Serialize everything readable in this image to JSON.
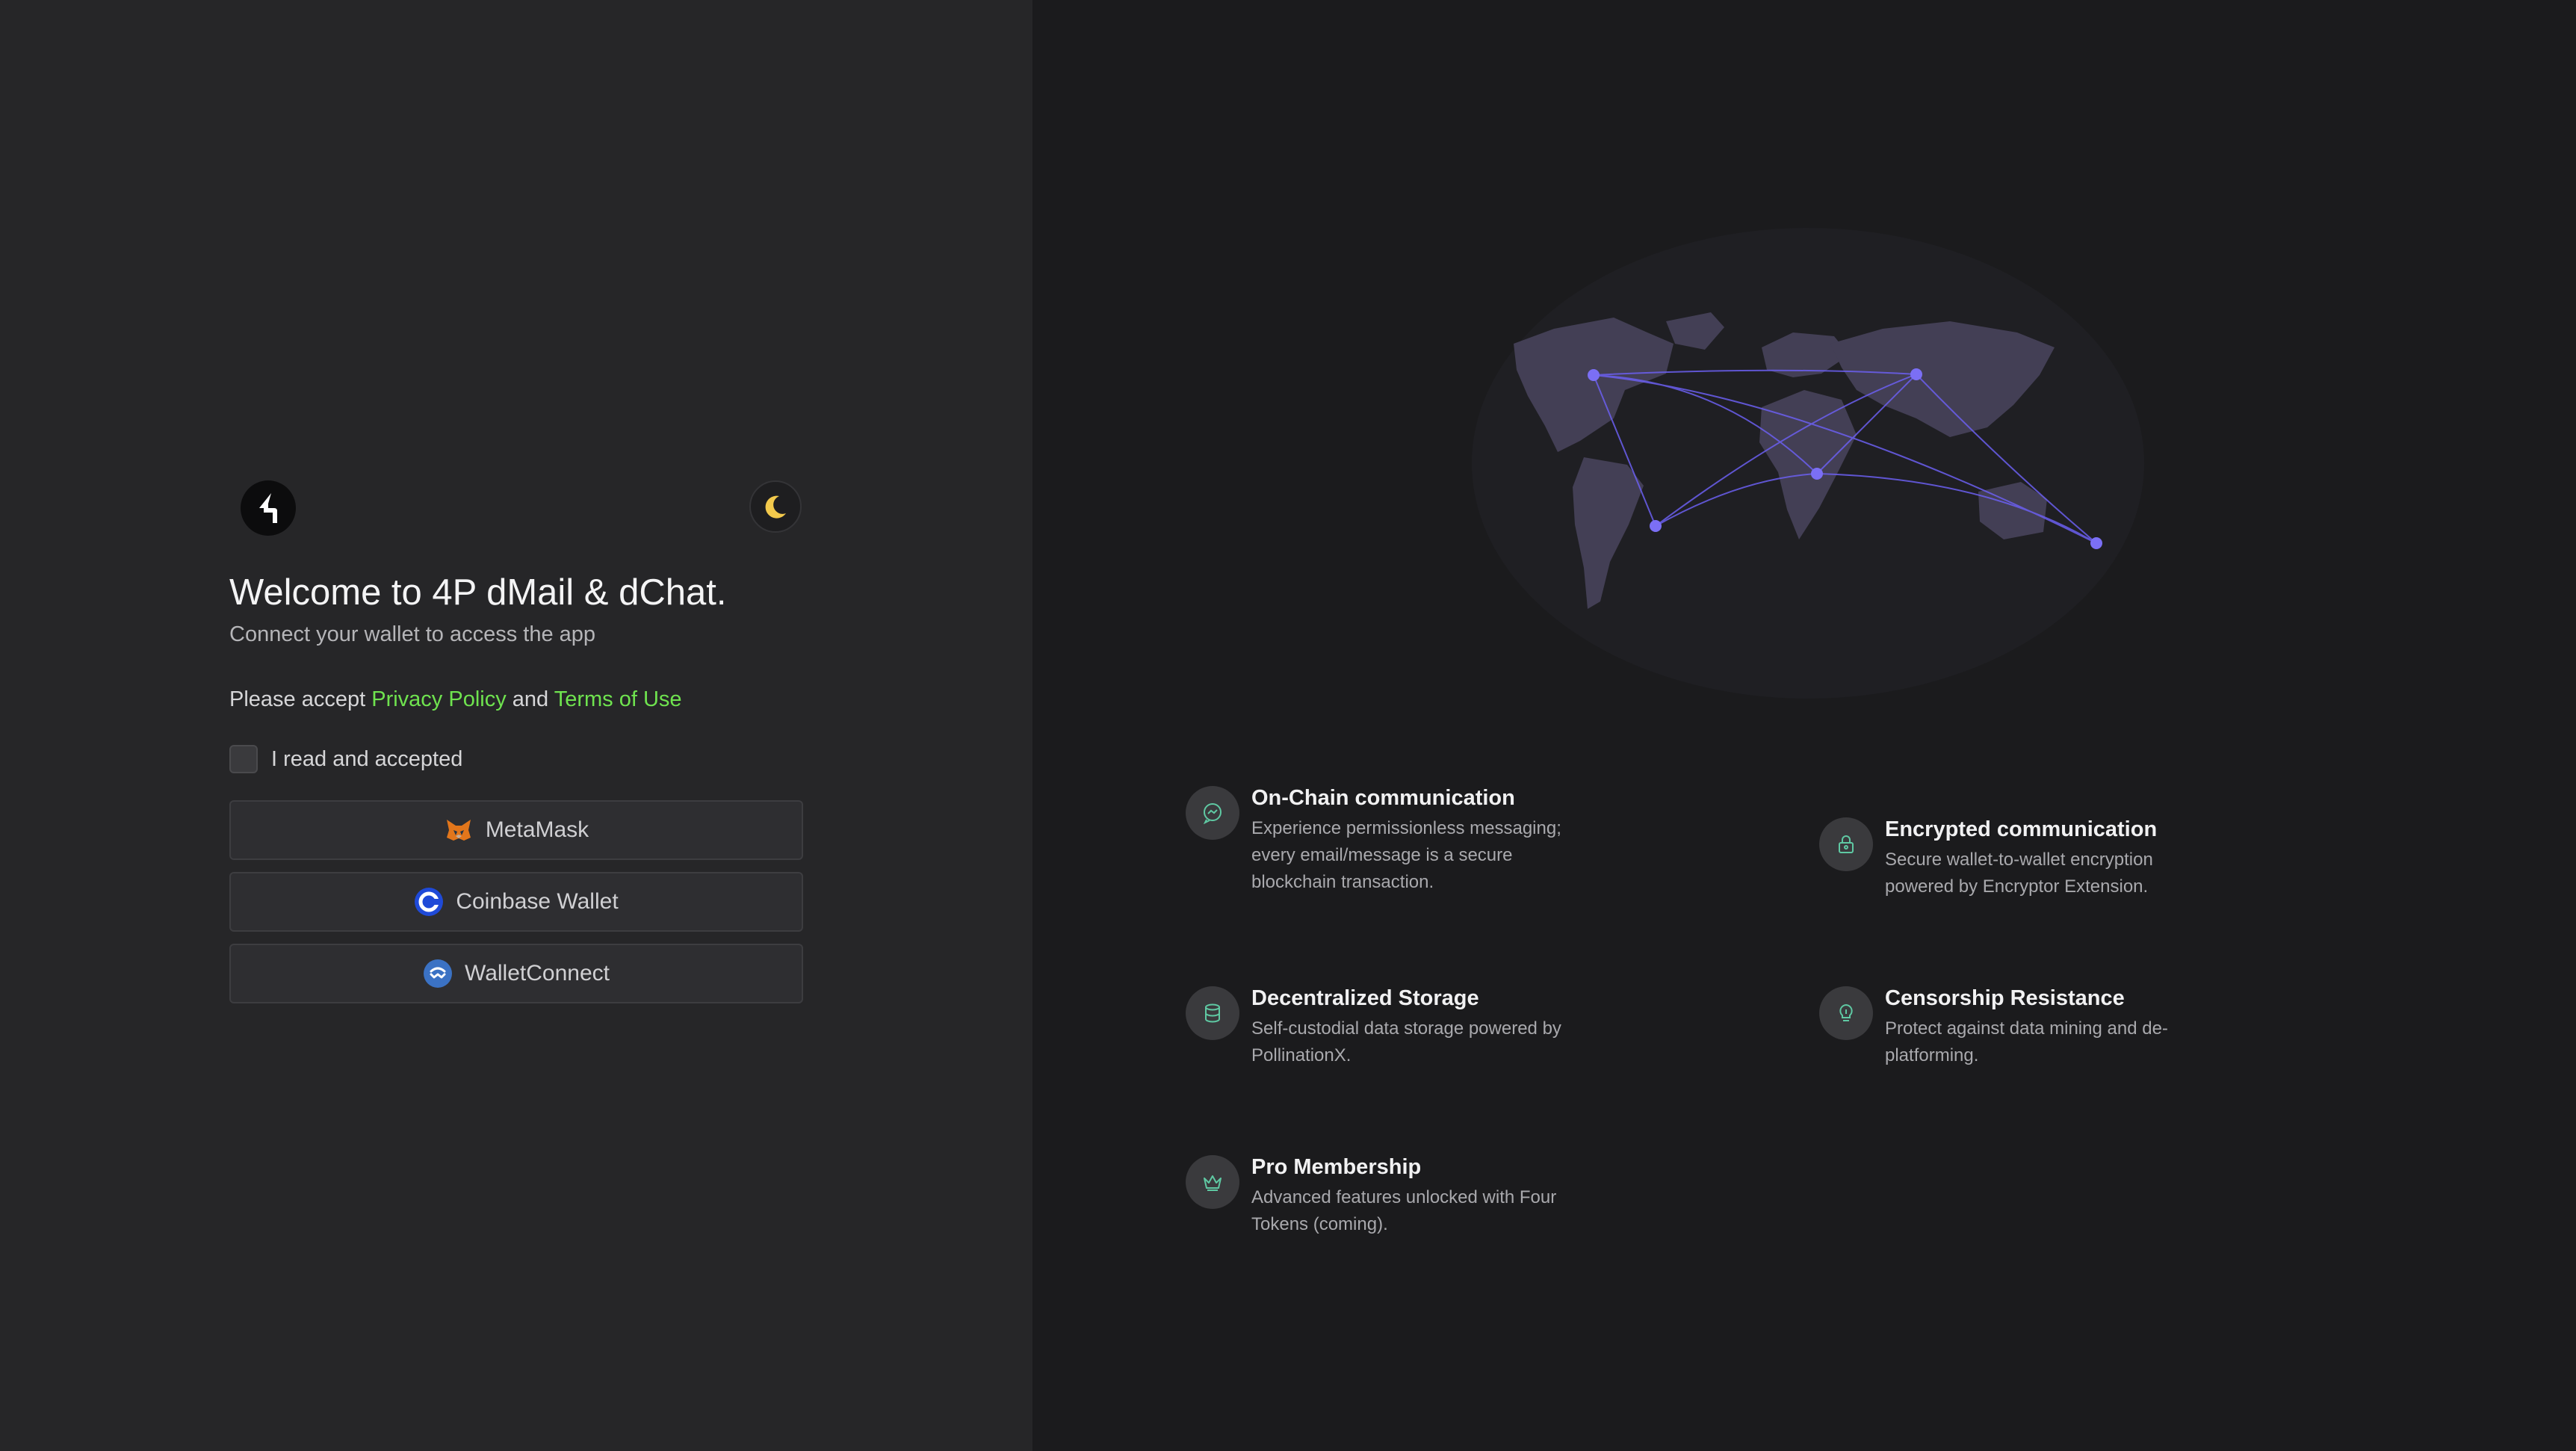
{
  "app": {
    "title": "Welcome to 4P dMail & dChat.",
    "subtitle": "Connect your wallet to access the app"
  },
  "terms": {
    "prefix": "Please accept ",
    "privacy_link": "Privacy Policy",
    "conjunction": " and ",
    "terms_link": "Terms of Use"
  },
  "checkbox": {
    "label": "I read and accepted",
    "checked": false
  },
  "wallets": [
    {
      "label": "MetaMask",
      "icon": "metamask-fox-icon"
    },
    {
      "label": "Coinbase Wallet",
      "icon": "coinbase-icon"
    },
    {
      "label": "WalletConnect",
      "icon": "walletconnect-icon"
    }
  ],
  "features": [
    {
      "title": "On-Chain communication",
      "description": "Experience permissionless messaging; every email/message is a secure blockchain transaction.",
      "icon": "chat-bubble-icon"
    },
    {
      "title": "Encrypted communication",
      "description": "Secure wallet-to-wallet encryption powered by Encryptor Extension.",
      "icon": "lock-icon"
    },
    {
      "title": "Decentralized Storage",
      "description": "Self-custodial data storage powered by PollinationX.",
      "icon": "database-icon"
    },
    {
      "title": "Censorship Resistance",
      "description": "Protect against data mining and de-platforming.",
      "icon": "lightbulb-icon"
    },
    {
      "title": "Pro Membership",
      "description": "Advanced features unlocked with Four Tokens (coming).",
      "icon": "crown-icon"
    }
  ],
  "colors": {
    "accent_link": "#6fe34f",
    "map_land": "#433f55",
    "map_route": "#6b5ff0",
    "feature_icon": "#5fc9a3",
    "moon": "#f2c94c"
  }
}
